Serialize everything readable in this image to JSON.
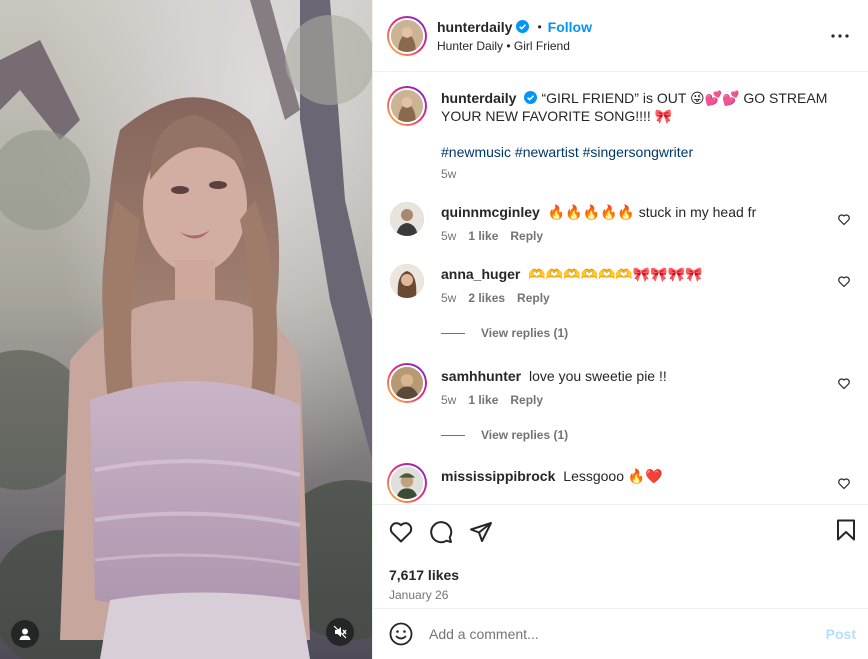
{
  "header": {
    "username": "hunterdaily",
    "dot": "•",
    "follow_label": "Follow",
    "subtitle": "Hunter Daily • Girl Friend"
  },
  "caption": {
    "username": "hunterdaily",
    "text": "“GIRL FRIEND” is OUT 😜💕💕 GO STREAM YOUR NEW FAVORITE SONG!!!! 🎀",
    "hashtags": "#newmusic #newartist #singersongwriter",
    "time": "5w"
  },
  "comments": [
    {
      "username": "quinnmcginley",
      "text": "🔥🔥🔥🔥🔥 stuck in my head fr",
      "time": "5w",
      "likes": "1 like",
      "reply": "Reply"
    },
    {
      "username": "anna_huger",
      "text": "🫶🫶🫶🫶🫶🫶🎀🎀🎀🎀",
      "time": "5w",
      "likes": "2 likes",
      "reply": "Reply",
      "view_replies": "View replies (1)"
    },
    {
      "username": "samhhunter",
      "text": "love you sweetie pie !!",
      "time": "5w",
      "likes": "1 like",
      "reply": "Reply",
      "view_replies": "View replies (1)"
    },
    {
      "username": "mississippibrock",
      "text": "Lessgooo 🔥❤️"
    }
  ],
  "footer": {
    "likes": "7,617 likes",
    "date": "January 26",
    "comment_placeholder": "Add a comment...",
    "post_label": "Post"
  },
  "colors": {
    "link": "#0095f6",
    "hashtag": "#00376b",
    "muted": "#737373",
    "post_disabled": "#b2dffc"
  },
  "icons": [
    "user-tag-icon",
    "mute-icon",
    "verified-icon",
    "more-icon",
    "heart-icon",
    "comment-icon",
    "share-icon",
    "bookmark-icon",
    "emoji-icon"
  ]
}
